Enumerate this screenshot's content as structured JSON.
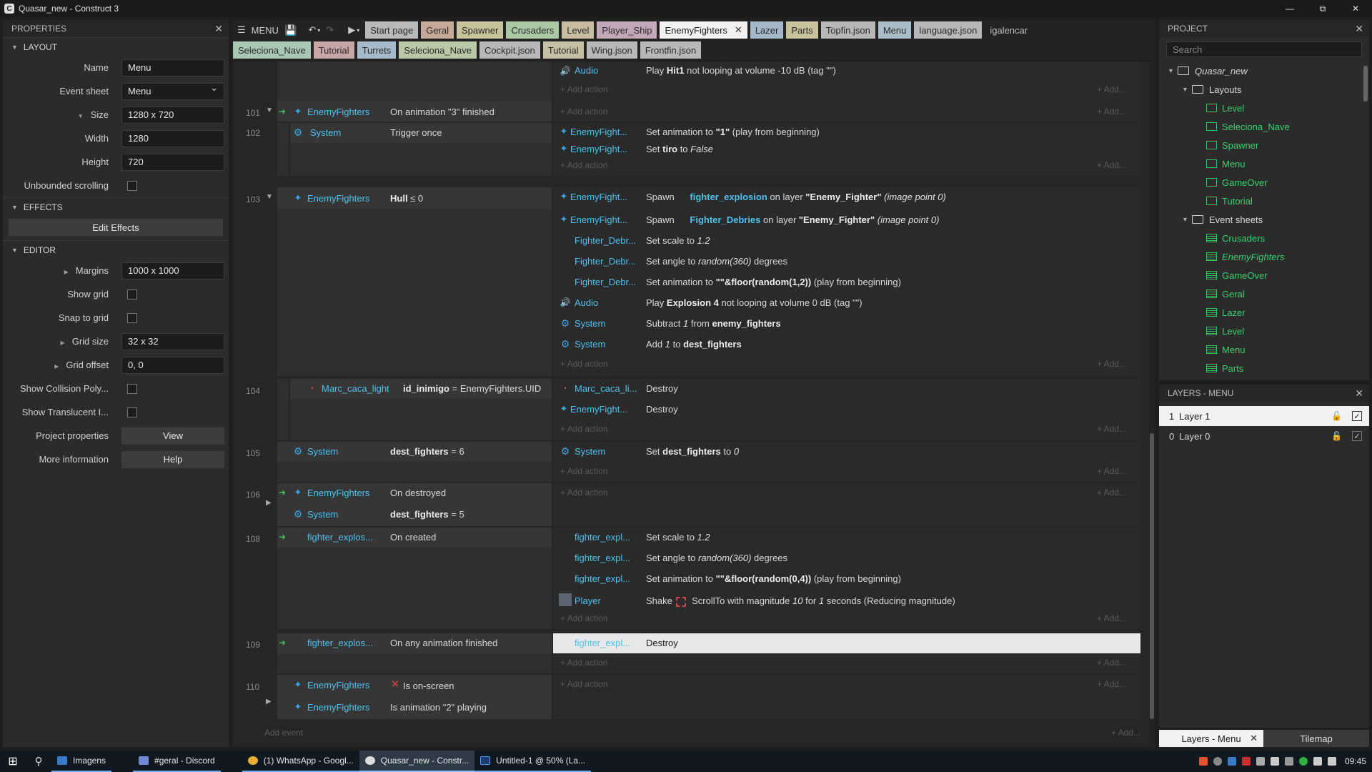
{
  "window": {
    "title": "Quasar_new - Construct 3",
    "app_icon": "C"
  },
  "properties": {
    "header": "PROPERTIES",
    "sections": {
      "layout": "LAYOUT",
      "effects": "EFFECTS",
      "editor": "EDITOR"
    },
    "layout_props": {
      "name_label": "Name",
      "name_value": "Menu",
      "event_sheet_label": "Event sheet",
      "event_sheet_value": "Menu",
      "size_label": "Size",
      "size_value": "1280 x 720",
      "width_label": "Width",
      "width_value": "1280",
      "height_label": "Height",
      "height_value": "720",
      "unbounded_label": "Unbounded scrolling"
    },
    "edit_effects": "Edit Effects",
    "editor_props": {
      "margins_label": "Margins",
      "margins_value": "1000 x 1000",
      "show_grid_label": "Show grid",
      "snap_grid_label": "Snap to grid",
      "grid_size_label": "Grid size",
      "grid_size_value": "32 x 32",
      "grid_offset_label": "Grid offset",
      "grid_offset_value": "0, 0",
      "show_collision_label": "Show Collision Poly...",
      "show_translucent_label": "Show Translucent I...",
      "project_props_label": "Project properties",
      "project_props_btn": "View",
      "more_info_label": "More information",
      "more_info_btn": "Help"
    }
  },
  "toolbar": {
    "menu_label": "MENU"
  },
  "tabs_row1": [
    {
      "label": "Start page",
      "color": "#b9b9b9"
    },
    {
      "label": "Geral",
      "color": "#c7a99a"
    },
    {
      "label": "Spawner",
      "color": "#c8c19a"
    },
    {
      "label": "Crusaders",
      "color": "#a9c8a3"
    },
    {
      "label": "Level",
      "color": "#c9bda0"
    },
    {
      "label": "Player_Ship",
      "color": "#c2a7b9"
    },
    {
      "label": "EnemyFighters",
      "active": true
    },
    {
      "label": "Lazer",
      "color": "#a3b7c8"
    },
    {
      "label": "Parts",
      "color": "#c9c19c"
    },
    {
      "label": "Topfin.json",
      "color": "#b8b8b8"
    },
    {
      "label": "Menu",
      "color": "#a9bdc8"
    },
    {
      "label": "language.json",
      "color": "#b8b8b8"
    },
    {
      "label": "igalencar",
      "plain": true
    }
  ],
  "tabs_row2": [
    {
      "label": "Seleciona_Nave",
      "color": "#a9c8b4"
    },
    {
      "label": "Tutorial",
      "color": "#c9a6a6"
    },
    {
      "label": "Turrets",
      "color": "#a7bac9"
    },
    {
      "label": "Seleciona_Nave",
      "color": "#b9c8a6"
    },
    {
      "label": "Cockpit.json",
      "color": "#b8b8b8"
    },
    {
      "label": "Tutorial",
      "color": "#c6bfa3"
    },
    {
      "label": "Wing.json",
      "color": "#b8b8b8"
    },
    {
      "label": "Frontfin.json",
      "color": "#b8b8b8"
    }
  ],
  "sheet": {
    "add_action": "+ Add action",
    "add_short": "+ Add...",
    "add_event": "Add event",
    "events": {
      "top": {
        "obj": "Audio",
        "action": "Play",
        "b1": "Hit1",
        "rest": " not looping at volume -10 dB (tag \"\")"
      },
      "e101": {
        "no": "101",
        "obj": "EnemyFighters",
        "cond": "On animation \"3\" finished"
      },
      "e102": {
        "no": "102",
        "obj": "System",
        "cond": "Trigger once",
        "a1_obj": "EnemyFight...",
        "a1_pre": "Set animation to ",
        "a1_b": "\"1\"",
        "a1_post": " (play from beginning)",
        "a2_obj": "EnemyFight...",
        "a2_pre": "Set ",
        "a2_b": "tiro",
        "a2_mid": " to ",
        "a2_i": "False"
      },
      "e103": {
        "no": "103",
        "obj": "EnemyFighters",
        "cond_b": "Hull",
        "cond_rest": " ≤ 0",
        "a1_obj": "EnemyFight...",
        "a1_pre": "Spawn",
        "a1_hl": "fighter_explosion",
        "a1_mid": " on layer ",
        "a1_b": "\"Enemy_Fighter\"",
        "a1_i": " (image point 0)",
        "a2_obj": "EnemyFight...",
        "a2_pre": "Spawn",
        "a2_hl": "Fighter_Debries",
        "a2_mid": " on layer ",
        "a2_b": "\"Enemy_Fighter\"",
        "a2_i": " (image point 0)",
        "a3_obj": "Fighter_Debr...",
        "a3_pre": "Set scale to ",
        "a3_i": "1.2",
        "a4_obj": "Fighter_Debr...",
        "a4_pre": "Set angle to ",
        "a4_i": "random(360)",
        "a4_post": " degrees",
        "a5_obj": "Fighter_Debr...",
        "a5_pre": "Set animation to ",
        "a5_b": "\"\"&floor(random(1,2))",
        "a5_post": " (play from beginning)",
        "a6_obj": "Audio",
        "a6_pre": "Play ",
        "a6_b": "Explosion 4",
        "a6_post": " not looping at volume 0 dB (tag \"\")",
        "a7_obj": "System",
        "a7_pre": "Subtract ",
        "a7_i": "1",
        "a7_mid": " from ",
        "a7_b": "enemy_fighters",
        "a8_obj": "System",
        "a8_pre": "Add ",
        "a8_i": "1",
        "a8_mid": " to ",
        "a8_b": "dest_fighters"
      },
      "e104": {
        "no": "104",
        "obj": "Marc_caca_light",
        "cond_b": "id_inimigo",
        "cond_rest": " = EnemyFighters.UID",
        "a1_obj": "Marc_caca_li...",
        "a1_txt": "Destroy",
        "a2_obj": "EnemyFight...",
        "a2_txt": "Destroy"
      },
      "e105": {
        "no": "105",
        "obj": "System",
        "cond_b": "dest_fighters",
        "cond_rest": " = 6",
        "a1_obj": "System",
        "a1_pre": "Set ",
        "a1_b": "dest_fighters",
        "a1_mid": " to ",
        "a1_i": "0"
      },
      "e106": {
        "no": "106",
        "obj1": "EnemyFighters",
        "cond1": "On destroyed",
        "obj2": "System",
        "cond2_b": "dest_fighters",
        "cond2_rest": " = 5"
      },
      "e108": {
        "no": "108",
        "obj": "fighter_explos...",
        "cond": "On created",
        "a1_obj": "fighter_expl...",
        "a1_pre": "Set scale to ",
        "a1_i": "1.2",
        "a2_obj": "fighter_expl...",
        "a2_pre": "Set angle to ",
        "a2_i": "random(360)",
        "a2_post": " degrees",
        "a3_obj": "fighter_expl...",
        "a3_pre": "Set animation to ",
        "a3_b": "\"\"&floor(random(0,4))",
        "a3_post": " (play from beginning)",
        "a4_obj": "Player",
        "a4_pre": "Shake ",
        "a4_mid": " ScrollTo with magnitude ",
        "a4_i1": "10",
        "a4_for": " for ",
        "a4_i2": "1",
        "a4_post": " seconds (Reducing magnitude)"
      },
      "e109": {
        "no": "109",
        "obj": "fighter_explos...",
        "cond": "On any animation finished",
        "a1_obj": "fighter_expl...",
        "a1_txt": "Destroy"
      },
      "e110": {
        "no": "110",
        "obj1": "EnemyFighters",
        "cond1": "Is on-screen",
        "obj2": "EnemyFighters",
        "cond2": "Is animation \"2\" playing"
      }
    }
  },
  "project": {
    "header": "PROJECT",
    "search_placeholder": "Search",
    "root": "Quasar_new",
    "layouts_folder": "Layouts",
    "layouts": [
      "Level",
      "Seleciona_Nave",
      "Spawner",
      "Menu",
      "GameOver",
      "Tutorial"
    ],
    "sheets_folder": "Event sheets",
    "sheets": [
      "Crusaders",
      "EnemyFighters",
      "GameOver",
      "Geral",
      "Lazer",
      "Level",
      "Menu",
      "Parts"
    ]
  },
  "layers": {
    "header": "LAYERS - MENU",
    "items": [
      {
        "num": "1",
        "name": "Layer 1"
      },
      {
        "num": "0",
        "name": "Layer 0"
      }
    ],
    "tab_active": "Layers - Menu",
    "tab_other": "Tilemap"
  },
  "taskbar": {
    "items": [
      "Imagens",
      "#geral - Discord",
      "(1) WhatsApp - Googl...",
      "Quasar_new - Constr...",
      "Untitled-1 @ 50% (La..."
    ],
    "clock": "09:45"
  },
  "colors": {
    "accent": "#4ec1f0",
    "green": "#38d070",
    "selected_tab": "#f2f2f2"
  }
}
